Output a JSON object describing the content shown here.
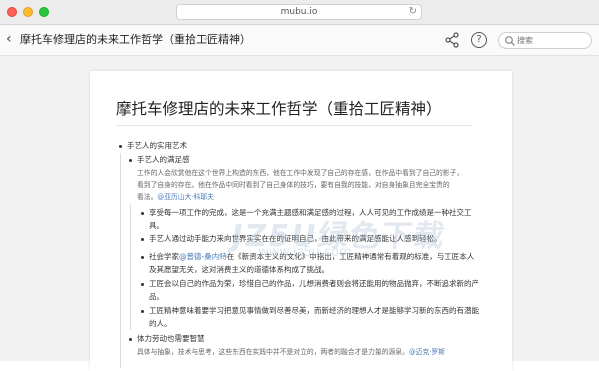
{
  "window": {
    "url": "mubu.io",
    "reload_icon": "reload-icon"
  },
  "toolbar": {
    "back_icon": "chevron-left-icon",
    "doc_title": "摩托车修理店的未来工作哲学（重拾工匠精神）",
    "undo_icon": "undo-icon",
    "redo_icon": "redo-icon",
    "share_icon": "share-icon",
    "help_label": "?",
    "search_placeholder": "搜索"
  },
  "document": {
    "title": "摩托车修理店的未来工作哲学（重拾工匠精神）",
    "l1_1": "手艺人的实用艺术",
    "l2_1": "手艺人的满足感",
    "l2_1_note_1": "工作的人会欣赏他在这个世界上构造的东西，他在工作中发现了自己的存在感，在作品中看到了自己的影子，",
    "l2_1_note_2": "看到了自身的存在。他在作品中同时看到了自己身体的技巧，要有自我的技能，对自身抽象且完全宝贵的",
    "l2_1_note_3_text": "看法。",
    "l2_1_note_3_link": "@亚历山大·科耶夫",
    "l3_1": "享受每一项工作的完成，这是一个充满主题感和满足感的过程，人人可见的工作成绩是一种社交工",
    "l3_1_cont": "具。",
    "l3_2": "手艺人通过动手能力来向世界实实在在的证明自己，由此带来的满足感能让人感到轻松。",
    "l3_3_pre": "社会学家",
    "l3_3_link": "@普德-桑内特",
    "l3_3_post": "在《新资本主义的文化》中指出，工匠精神通常有着观的标准，与工匠本人",
    "l3_3_cont": "及其愿望无关，这对消费主义的道德体系构成了挑战。",
    "l3_4": "工匠会以自己的作品为荣，珍惜自己的作品，儿想消费者则会将还能用的物品抛弃，不断追求新的产",
    "l3_4_cont": "品。",
    "l3_5": "工匠精神意味着要学习把意见事情做到尽善尽美，而新经济的理想人才是能够学习新的东西的有潜能",
    "l3_5_cont": "的人。",
    "l2_2": "体力劳动也需要智慧",
    "l2_2_note_text": "具体与抽象，技术与思考，这些东西在实践中并不是对立的，两者的融合才是力量的源泉。",
    "l2_2_note_link": "@迈克·罗斯"
  },
  "watermark": {
    "main": "JZ5U绿色下载",
    "sub": "www.jz5u.com"
  }
}
